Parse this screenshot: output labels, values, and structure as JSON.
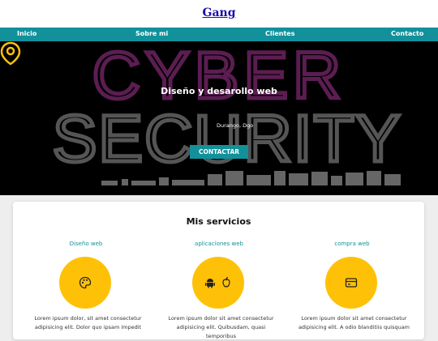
{
  "header": {
    "brand": "Gang"
  },
  "nav": {
    "items": [
      "Inicio",
      "Sobre mi",
      "Clientes",
      "Contacto"
    ]
  },
  "hero": {
    "background_text_line1": "CYBER",
    "background_text_line2": "SECURITY",
    "title": "Diseño y desarollo web",
    "location": "Durango, Dgo",
    "cta_label": "CONTACTAR"
  },
  "services": {
    "title": "Mis servicios",
    "items": [
      {
        "title": "Diseño web",
        "icon": "palette-icon",
        "description": "Lorem ipsum dolor, sit amet consectetur adipisicing elit. Dolor quo ipsam impedit"
      },
      {
        "title": "aplicaciones web",
        "icon": "android-apple-icon",
        "description": "Lorem ipsum dolor sit amet consectetur adipisicing elit. Quibusdam, quasi temporibus"
      },
      {
        "title": "compra web",
        "icon": "credit-card-icon",
        "description": "Lorem ipsum dolor sit amet consectetur adipisicing elit. A odio blanditiis quisquam"
      }
    ]
  },
  "colors": {
    "accent": "#12919b",
    "icon_circle": "#ffc107",
    "hero_bg": "#000000",
    "hero_text_purple": "#5c1d52",
    "hero_text_gray": "#555555"
  }
}
